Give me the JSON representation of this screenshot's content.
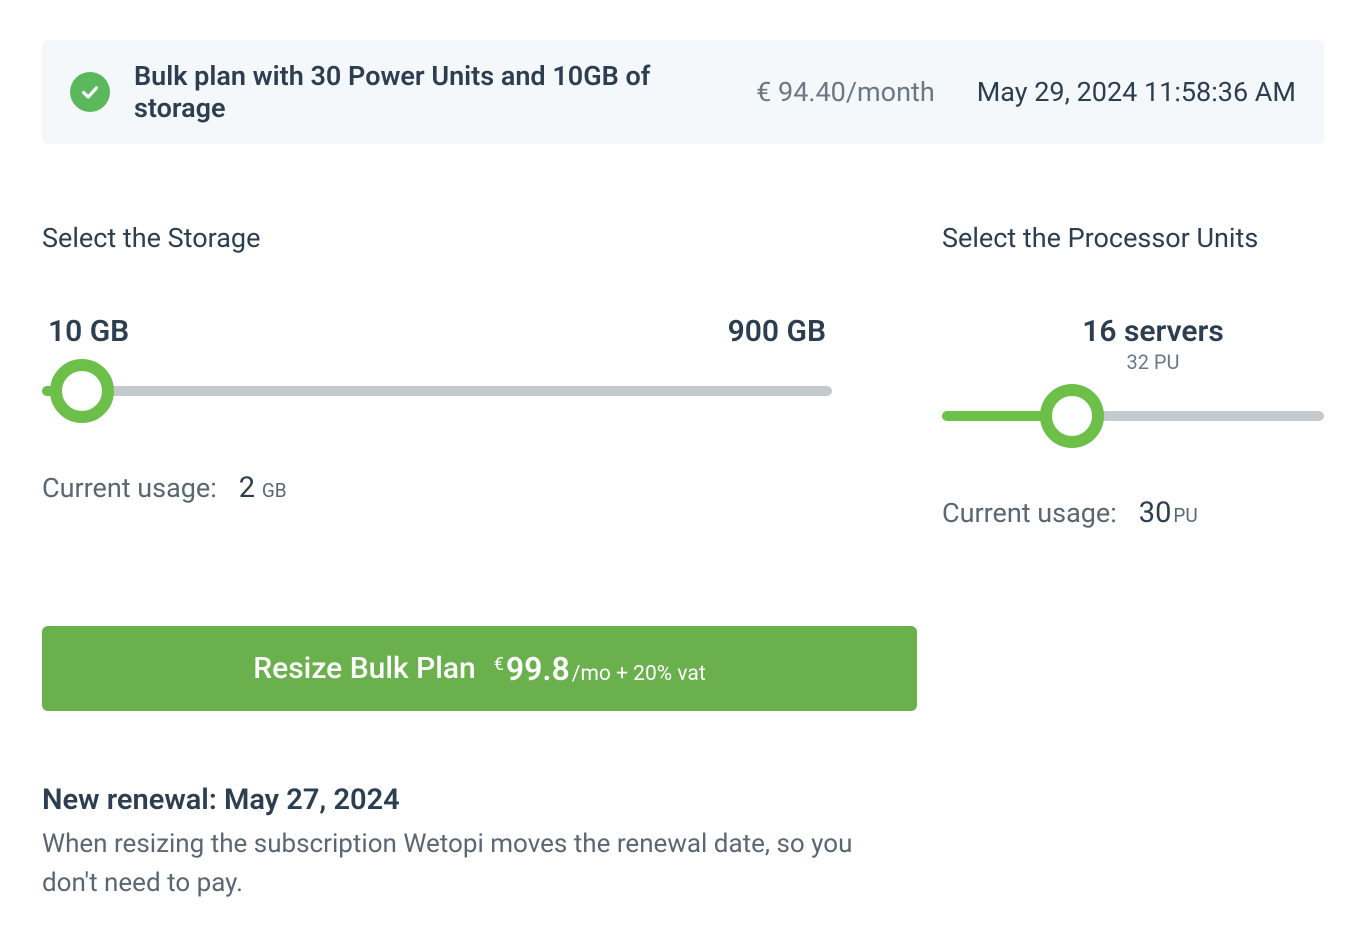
{
  "banner": {
    "title": "Bulk plan with 30 Power Units and 10GB of storage",
    "price": "€ 94.40/month",
    "date": "May 29, 2024 11:58:36 AM"
  },
  "storage": {
    "title": "Select the Storage",
    "min_label": "10 GB",
    "max_label": "900 GB",
    "slider_percent": 5,
    "usage_label": "Current usage:",
    "usage_value": "2",
    "usage_unit": " GB"
  },
  "pu": {
    "title": "Select the Processor Units",
    "servers_label": "16 servers",
    "pu_label": "32 PU",
    "slider_percent": 34,
    "usage_label": "Current usage:",
    "usage_value": "30",
    "usage_unit": "PU"
  },
  "resize": {
    "label": "Resize Bulk Plan",
    "currency": "€",
    "price": "99.8",
    "suffix": "/mo + 20% vat"
  },
  "renewal": {
    "title": "New renewal: May 27, 2024",
    "desc": "When resizing the subscription Wetopi moves the renewal date, so you don't need to pay."
  }
}
